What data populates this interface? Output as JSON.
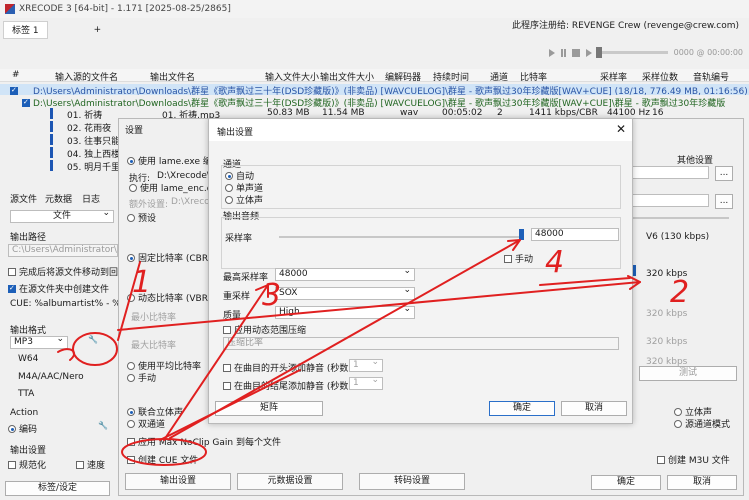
{
  "app": {
    "title": "XRECODE 3 [64-bit] - 1.171 [2025-08-25/2865]",
    "registered": "此程序注册给: REVENGE Crew (revenge@crew.com)",
    "tab": "标签 1",
    "add_tab": "+"
  },
  "playback": {
    "time": "0000 @ 00:00:00"
  },
  "table": {
    "headers": [
      "#",
      "输入源的文件名",
      "输出文件名",
      "输入文件大小",
      "输出文件大小",
      "编解码器",
      "持续时间",
      "通道",
      "比特率",
      "采样率",
      "采样位数",
      "音轨编号"
    ],
    "row1": "D:\\Users\\Administrator\\Downloads\\群星《歌声飘过三十年(DSD珍藏版)》(非卖品) [WAVCUELOG]\\群星 - 歌声飘过30年珍藏版[WAV+CUE] (18/18, 776.49 MB, 01:16:56)",
    "row2": "D:\\Users\\Administrator\\Downloads\\群星《歌声飘过三十年(DSD珍藏版)》(非卖品) [WAVCUELOG]\\群星 - 歌声飘过30年珍藏版[WAV+CUE]\\群星 - 歌声飘过30年珍藏版",
    "tracks": [
      {
        "num": "01. 祈祷",
        "out": "01. 祈祷.mp3",
        "insize": "50.83 MB",
        "outsize": "11.54 MB",
        "codec": "wav",
        "dur": "00:05:02",
        "ch": "2",
        "br": "1411 kbps/CBR",
        "sr": "44100 Hz",
        "bits": "16"
      },
      {
        "num": "02. 花雨夜"
      },
      {
        "num": "03. 往事只能"
      },
      {
        "num": "04. 独上西楼"
      },
      {
        "num": "05. 明月千里"
      }
    ]
  },
  "settings": {
    "title": "设置",
    "use_lame": "使用 lame.exe 编码",
    "exec_label": "执行:",
    "exec_path": "D:\\Xrecode\\",
    "use_lame_enc": "使用 lame_enc.dll",
    "extra_label": "额外设置:",
    "extra_path": "D:\\Xrecode\\",
    "preset": "预设",
    "cbr": "固定比特率 (CBR)",
    "vbr": "动态比特率 (VBR)",
    "min_br": "最小比特率",
    "max_br": "最大比特率",
    "abr": "使用平均比特率",
    "manual": "手动",
    "joint": "联合立体声",
    "dual": "双通道",
    "stereo": "立体声",
    "src_stereo": "源通道模式",
    "other": "其他设置",
    "v6": "V6 (130 kbps)",
    "kbps320a": "320 kbps",
    "kbps320b": "320 kbps",
    "kbps320c": "320 kbps",
    "kbps320d": "320 kbps",
    "test": "测试",
    "maxnoclip": "应用 Max NoClip Gain 到每个文件",
    "create_cue": "创建 CUE 文件",
    "create_m3u": "创建 M3U 文件",
    "tab_output": "输出设置",
    "tab_meta": "元数据设置",
    "tab_transcode": "转码设置",
    "ok": "确定",
    "cancel": "取消"
  },
  "left": {
    "src_tab": "源文件",
    "meta_tab": "元数据",
    "log_tab": "日志",
    "file_select": "文件",
    "output_path": "输出路径",
    "path_value": "C:\\Users\\Administrator\\Downloads",
    "move_src": "完成后将源文件移动到回收站",
    "create_folder": "在源文件夹中创建文件",
    "cue_label": "CUE: %albumartist% - %al",
    "fmt_label": "输出格式",
    "fmt_mp3": "MP3",
    "fmt_w64": "W64",
    "fmt_m4a": "M4A/AAC/Nero",
    "fmt_tta": "TTA",
    "action": "Action",
    "encode": "编码",
    "out_settings": "输出设置",
    "normalize": "规范化",
    "speed": "速度",
    "bottom_tab": "标签/设定"
  },
  "out_dialog": {
    "title": "输出设置",
    "channels": "通道",
    "auto": "自动",
    "mono": "单声道",
    "stereo": "立体声",
    "sr_section": "输出音频",
    "sample_rate": "采样率",
    "sr_value": "48000",
    "manual": "手动",
    "max_sr": "最高采样率",
    "max_sr_value": "48000",
    "resample": "重采样",
    "resample_value": "SOX",
    "quality": "质量",
    "quality_value": "High",
    "dyn_compress": "应用动态范围压缩",
    "compress_ratio": "压缩比率",
    "pad_start": "在曲目的开头添加静音 (秒数)",
    "pad_start_val": "1",
    "pad_end": "在曲目的结尾添加静音 (秒数)",
    "pad_end_val": "1",
    "matrix": "矩阵",
    "ok": "确定",
    "cancel": "取消"
  },
  "annotations": {
    "n1": "1",
    "n2": "2",
    "n3": "3",
    "n4": "4",
    "color": "#e02020"
  }
}
